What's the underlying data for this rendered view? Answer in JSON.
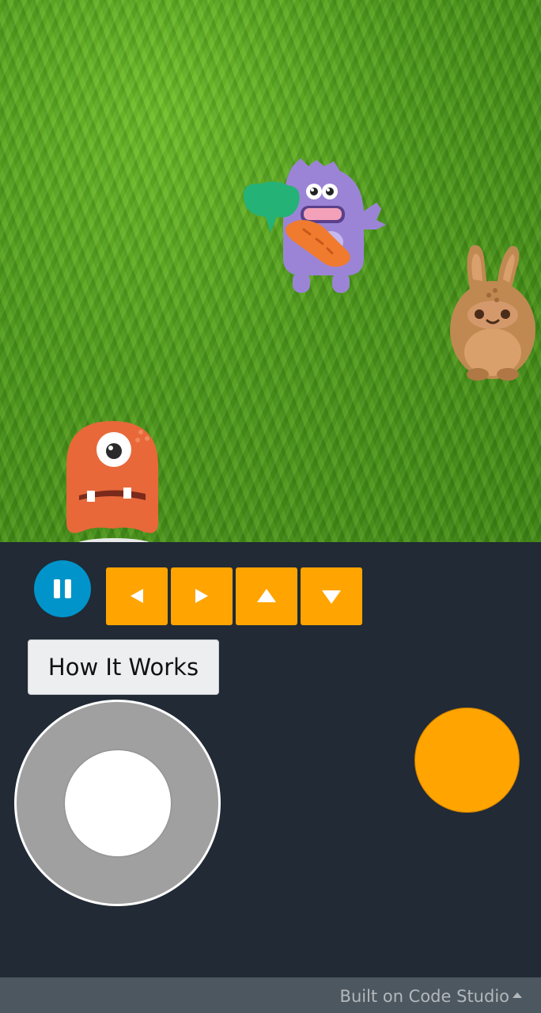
{
  "stage": {
    "background": "grass",
    "sprites": [
      {
        "name": "purple-monster",
        "color": "#9b84d6",
        "holding": [
          "leaf",
          "carrot"
        ]
      },
      {
        "name": "brown-bunny",
        "color": "#c08952"
      },
      {
        "name": "orange-one-eyed-monster",
        "color": "#e8683a"
      }
    ]
  },
  "controls": {
    "pause_icon": "pause-icon",
    "arrows": [
      "left-arrow-icon",
      "right-arrow-icon",
      "up-arrow-icon",
      "down-arrow-icon"
    ],
    "how_it_works_label": "How It Works",
    "accent_color": "#ffa400",
    "pause_color": "#0094ca"
  },
  "footer": {
    "label": "Built on Code Studio"
  }
}
